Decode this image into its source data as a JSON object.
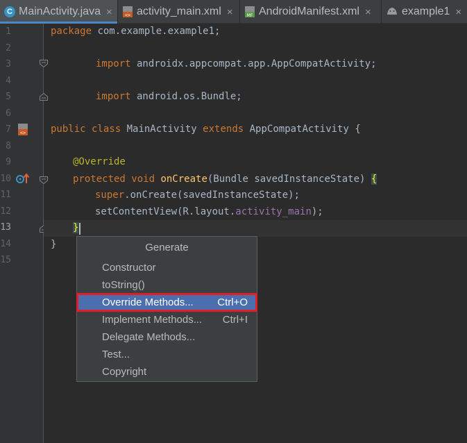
{
  "tabs": [
    {
      "label": "MainActivity.java",
      "icon": "java-class-icon",
      "active": true
    },
    {
      "label": "activity_main.xml",
      "icon": "xml-layout-icon",
      "active": false
    },
    {
      "label": "AndroidManifest.xml",
      "icon": "manifest-icon",
      "active": false
    },
    {
      "label": "example1",
      "icon": "android-icon",
      "active": false
    }
  ],
  "tab_close": "×",
  "gutter": {
    "line_numbers": [
      "1",
      "2",
      "3",
      "4",
      "5",
      "6",
      "7",
      "8",
      "9",
      "10",
      "11",
      "12",
      "13",
      "14",
      "15"
    ],
    "current_line": "13"
  },
  "code": {
    "l1": [
      "package",
      " com.example.example1;"
    ],
    "l3": [
      "import",
      " androidx.appcompat.app.AppCompatActivity;"
    ],
    "l5": [
      "import",
      " android.os.Bundle;"
    ],
    "l7": [
      "public class",
      " MainActivity ",
      "extends",
      " AppCompatActivity {"
    ],
    "l9": [
      "@Override"
    ],
    "l10": [
      "protected void",
      " ",
      "onCreate",
      "(Bundle savedInstanceState) ",
      "{"
    ],
    "l11": [
      "super",
      ".onCreate(savedInstanceState);"
    ],
    "l12": [
      "setContentView(R.layout.",
      "activity_main",
      ");"
    ],
    "l13": [
      "}"
    ],
    "l14": [
      "}"
    ]
  },
  "popup": {
    "title": "Generate",
    "items": [
      {
        "label": "Constructor",
        "shortcut": ""
      },
      {
        "label": "toString()",
        "shortcut": ""
      },
      {
        "label": "Override Methods...",
        "shortcut": "Ctrl+O",
        "selected": true
      },
      {
        "label": "Implement Methods...",
        "shortcut": "Ctrl+I"
      },
      {
        "label": "Delegate Methods...",
        "shortcut": ""
      },
      {
        "label": "Test...",
        "shortcut": ""
      },
      {
        "label": "Copyright",
        "shortcut": ""
      }
    ]
  },
  "colors": {
    "editor_bg": "#2b2b2b",
    "keyword": "#cc7832",
    "annotation": "#bbb529",
    "method": "#ffc66d",
    "field": "#9876aa",
    "selection": "#4b6eaf",
    "highlight_box": "#e11d26"
  }
}
